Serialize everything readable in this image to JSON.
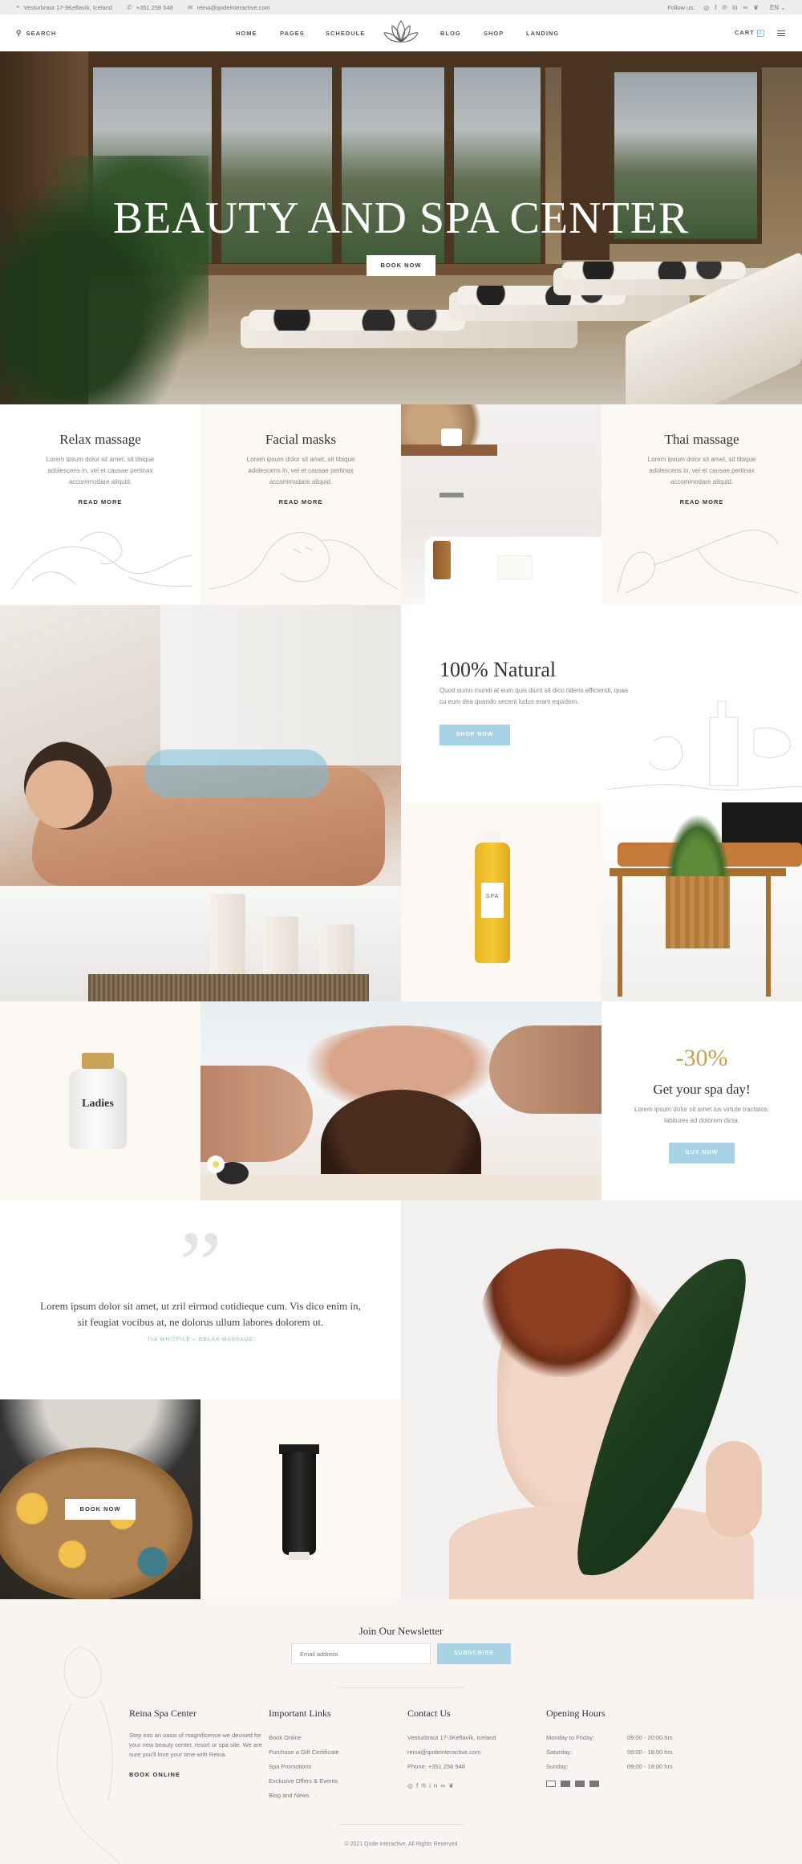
{
  "topbar": {
    "address": "Vesturbraut 17-3Keflavík, Iceland",
    "phone": "+351 258 548",
    "email": "reina@qodeinteractive.com",
    "follow_label": "Follow us:",
    "social_icons": [
      "instagram-icon",
      "facebook-icon",
      "pinterest-icon",
      "linkedin-icon",
      "tripadvisor-icon",
      "twitter-icon"
    ],
    "language": "EN"
  },
  "nav": {
    "search_label": "SEARCH",
    "items": [
      "HOME",
      "PAGES",
      "SCHEDULE",
      "BLOG",
      "SHOP",
      "LANDING"
    ],
    "cart_label": "CART",
    "cart_count": "0"
  },
  "hero": {
    "title": "BEAUTY AND SPA CENTER",
    "button": "BOOK NOW"
  },
  "services": [
    {
      "title": "Relax massage",
      "text": "Lorem ipsum dolor sit amet, sit tibique adolescens in, vel et causae pertinax accommodare aliquid.",
      "link": "READ MORE"
    },
    {
      "title": "Facial masks",
      "text": "Lorem ipsum dolor sit amet, sit tibique adolescens in, vel et causae pertinax accommodare aliquid.",
      "link": "READ MORE"
    },
    {
      "title": "Thai massage",
      "text": "Lorem ipsum dolor sit amet, sit tibique adolescens in, vel et causae pertinax accommodare aliquid.",
      "link": "READ MORE"
    }
  ],
  "natural": {
    "title": "100% Natural",
    "text": "Quod sumo mundi at eum quis diunt sit dico ridens efficiendi, quas cu eum dea quando secent ludus erant equidem.",
    "button": "SHOP NOW"
  },
  "products": {
    "bottle_label": "SPA",
    "ladies_label": "Ladies"
  },
  "offer": {
    "discount": "-30%",
    "title": "Get your spa day!",
    "text": "Lorem ipsum dolor sit amet ius virtute tractatos, labitures ad dolorem dicta.",
    "button": "BUY NOW"
  },
  "testimonial": {
    "quote": "Lorem ipsum dolor sit amet, ut zril eirmod cotidieque cum. Vis dico enim in, sit feugiat vocibus at, ne dolorus ullum labores dolorem ut.",
    "author": "TIA WHITFILE – RELAX MASSAGE"
  },
  "bowl_button": "BOOK NOW",
  "newsletter": {
    "title": "Join Our Newsletter",
    "placeholder": "Email address",
    "button": "SUBSCRIBE"
  },
  "footer": {
    "about_title": "Reina Spa Center",
    "about_text": "Step into an oasis of magnificence we devised for your new beauty center, resort or spa site. We are sure you'll love your time with Reina.",
    "about_link": "BOOK ONLINE",
    "links_title": "Important Links",
    "links": [
      "Book Online",
      "Purchase a Gift Certificate",
      "Spa Promotions",
      "Exclusive Offers & Events",
      "Blog and News"
    ],
    "contact_title": "Contact Us",
    "contact": [
      "Vesturbraut 17-3Keflavík, Iceland",
      "reina@qodeinteractive.com",
      "Phone: +351 258 548"
    ],
    "hours_title": "Opening Hours",
    "hours": [
      {
        "day": "Monday to Friday:",
        "time": "09:00 - 20:00 hrs"
      },
      {
        "day": "Saturday:",
        "time": "09:00 - 18:00 hrs"
      },
      {
        "day": "Sunday:",
        "time": "09:00 - 18:00 hrs"
      }
    ],
    "payment_icons": [
      "card-icon",
      "visa-icon",
      "amex-icon",
      "mastercard-icon"
    ],
    "copyright": "© 2021 Qode Interactive, All Rights Reserved"
  },
  "colors": {
    "accent_blue": "#a8d2e6",
    "gold": "#c8a04a",
    "cream": "#fbf7f3"
  }
}
